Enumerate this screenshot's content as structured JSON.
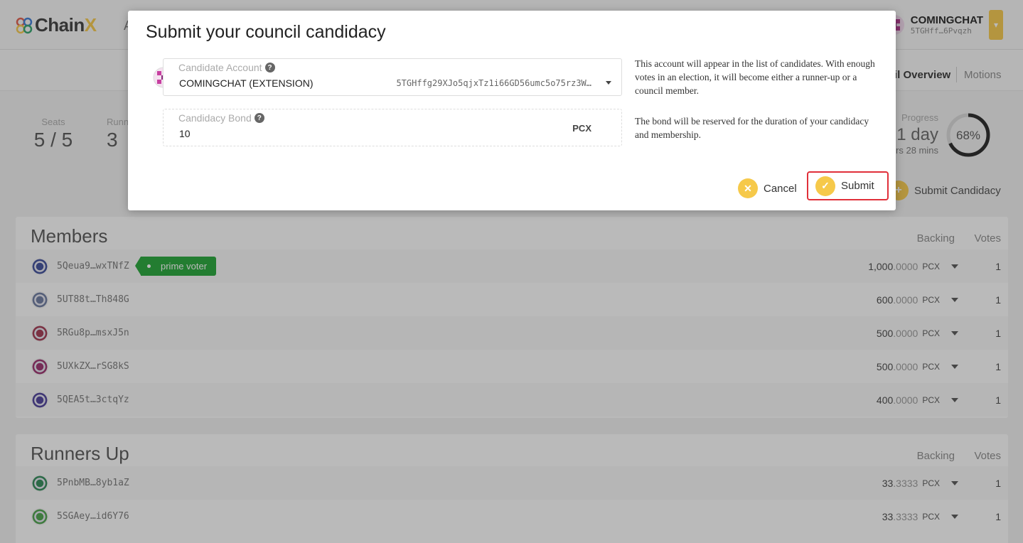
{
  "header": {
    "logo_text": "Chain",
    "logo_x": "X",
    "nav_fragment": "A",
    "account_name": "COMINGCHAT",
    "account_addr": "5TGHff…6Pvqzh"
  },
  "subnav": {
    "overview_label": "il Overview",
    "motions_label": "Motions"
  },
  "summary": {
    "seats_label": "Seats",
    "seats_value": "5 / 5",
    "runners_label": "Runn",
    "runners_value": "3",
    "progress_label": "Progress",
    "progress_value": "1 day",
    "progress_sub": "rs 28 mins",
    "progress_percent": "68%",
    "progress_fraction": 0.68,
    "submit_candidacy_label": "Submit Candidacy"
  },
  "members": {
    "title": "Members",
    "col_backing": "Backing",
    "col_votes": "Votes",
    "rows": [
      {
        "addr": "5Qeua9…wxTNfZ",
        "badge": "prime voter",
        "int": "1,000",
        "dec": ".0000",
        "unit": "PCX",
        "votes": "1",
        "color": "#3b4c9a"
      },
      {
        "addr": "5UT88t…Th848G",
        "badge": "",
        "int": "600",
        "dec": ".0000",
        "unit": "PCX",
        "votes": "1",
        "color": "#6a7aa0"
      },
      {
        "addr": "5RGu8p…msxJ5n",
        "badge": "",
        "int": "500",
        "dec": ".0000",
        "unit": "PCX",
        "votes": "1",
        "color": "#a3354e"
      },
      {
        "addr": "5UXkZX…rSG8kS",
        "badge": "",
        "int": "500",
        "dec": ".0000",
        "unit": "PCX",
        "votes": "1",
        "color": "#9b2f6d"
      },
      {
        "addr": "5QEA5t…3ctqYz",
        "badge": "",
        "int": "400",
        "dec": ".0000",
        "unit": "PCX",
        "votes": "1",
        "color": "#4b3d9a"
      }
    ]
  },
  "runners": {
    "title": "Runners Up",
    "col_backing": "Backing",
    "col_votes": "Votes",
    "rows": [
      {
        "addr": "5PnbMB…8yb1aZ",
        "int": "33",
        "dec": ".3333",
        "unit": "PCX",
        "votes": "1",
        "color": "#2e8a56"
      },
      {
        "addr": "5SGAey…id6Y76",
        "int": "33",
        "dec": ".3333",
        "unit": "PCX",
        "votes": "1",
        "color": "#4aa34a"
      }
    ]
  },
  "modal": {
    "title": "Submit your council candidacy",
    "account_label": "Candidate Account",
    "account_name": "COMINGCHAT (EXTENSION)",
    "account_address": "5TGHffg29XJo5qjxTz1i66GD56umc5o75rz3W…",
    "account_help": "This account will appear in the list of candidates. With enough votes in an election, it will become either a runner-up or a council member.",
    "bond_label": "Candidacy Bond",
    "bond_value": "10",
    "bond_unit": "PCX",
    "bond_help": "The bond will be reserved for the duration of your candidacy and membership.",
    "cancel_label": "Cancel",
    "submit_label": "Submit"
  },
  "colors": {
    "accent": "#f6c94a",
    "badge": "#21a535",
    "highlight": "#e0303a"
  }
}
